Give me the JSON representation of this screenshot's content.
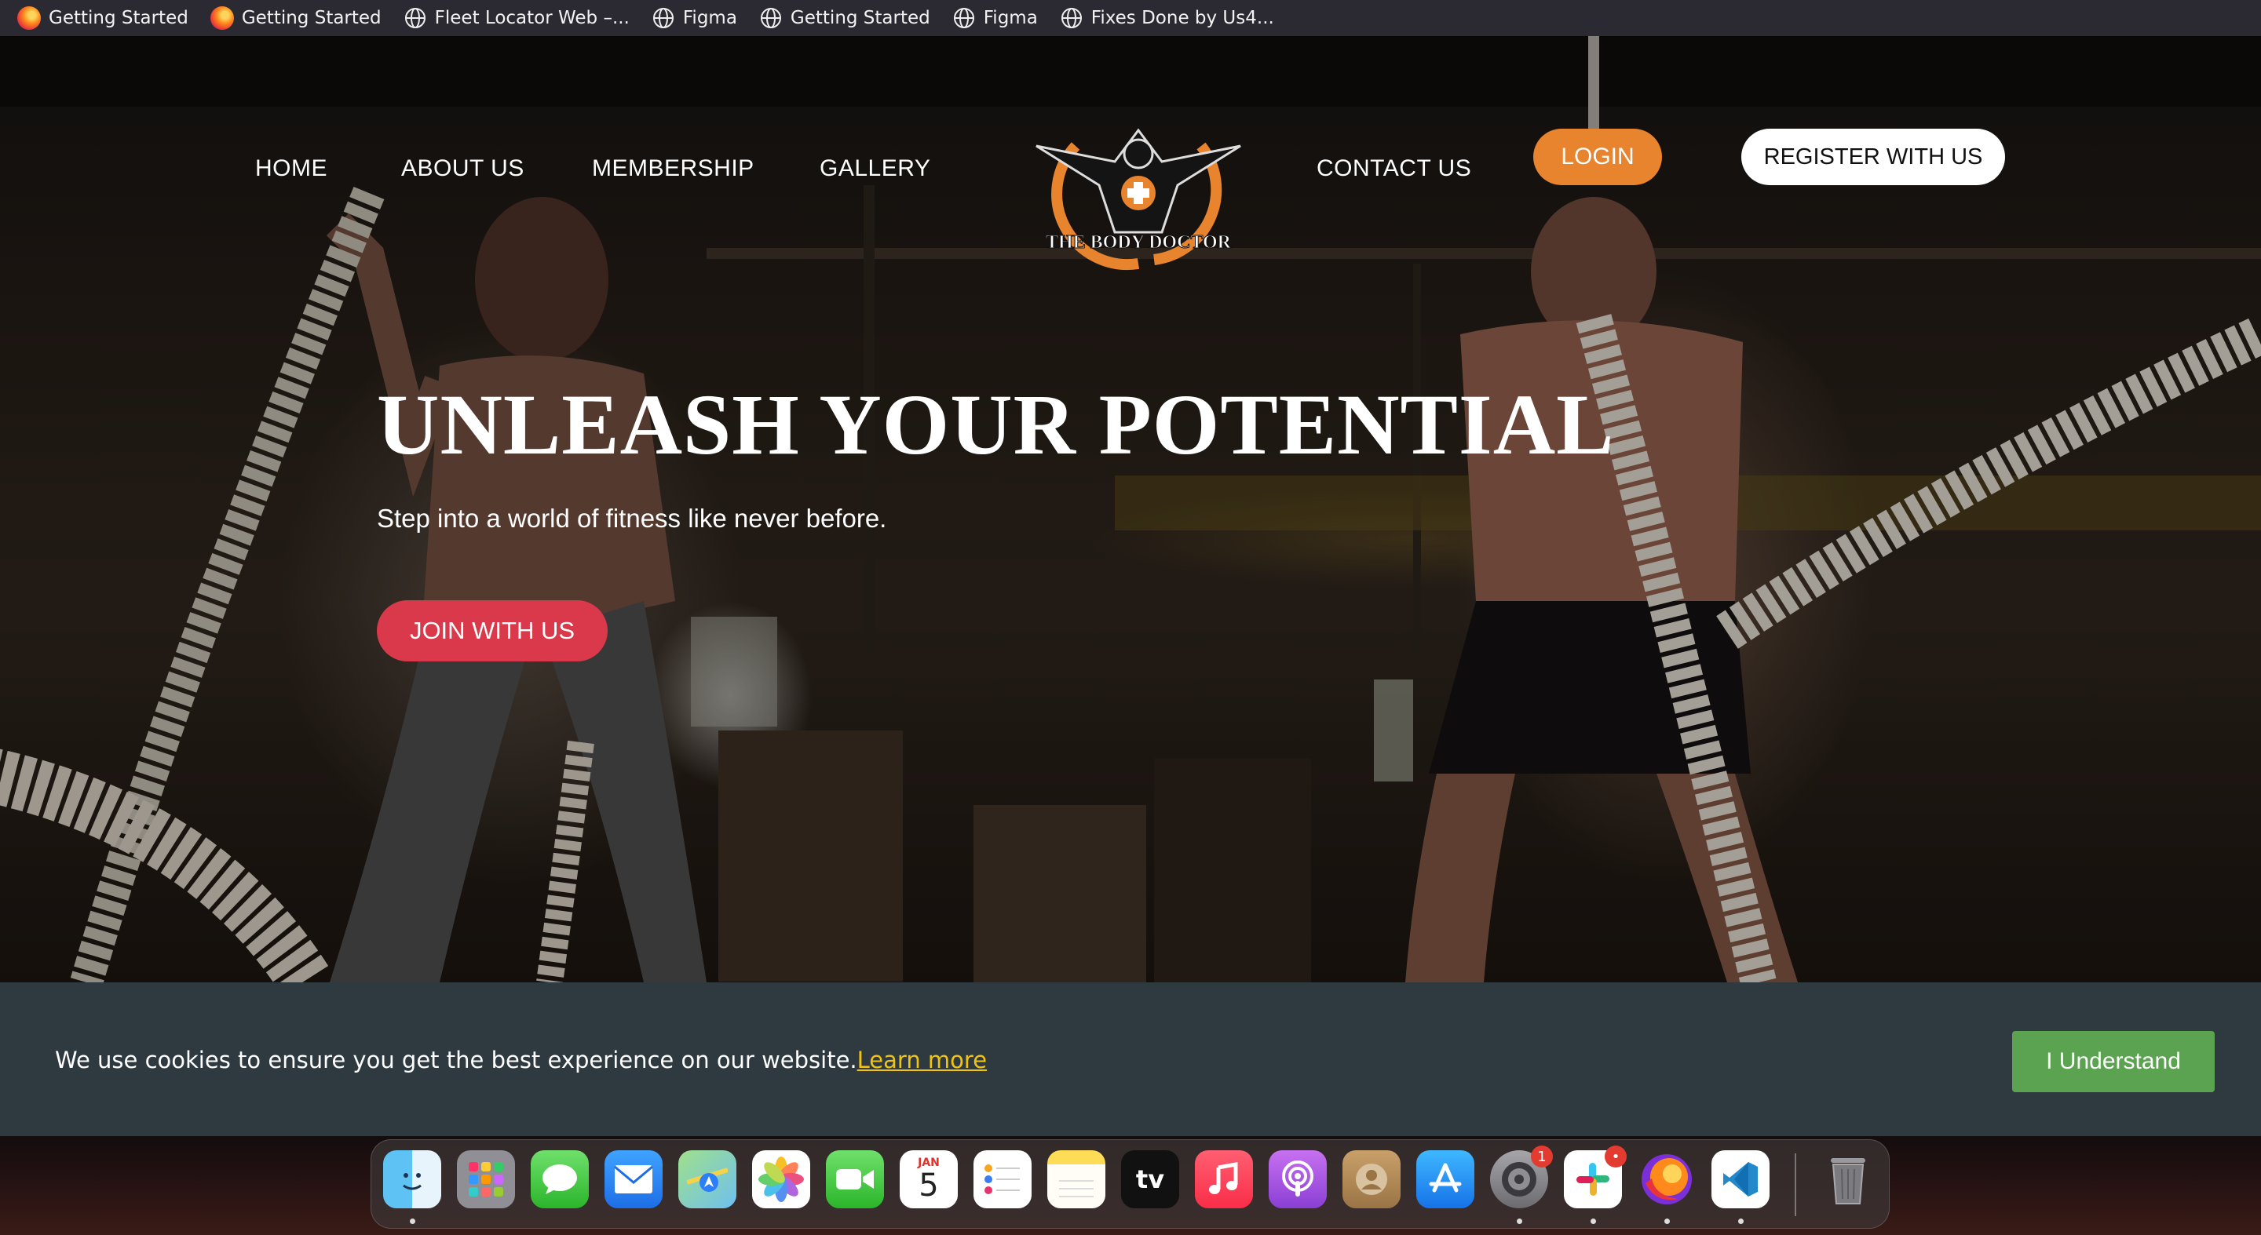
{
  "bookmarks": [
    {
      "label": "Getting Started",
      "icon": "firefox-icon"
    },
    {
      "label": "Getting Started",
      "icon": "firefox-icon"
    },
    {
      "label": "Fleet Locator Web –...",
      "icon": "globe-icon"
    },
    {
      "label": "Figma",
      "icon": "globe-icon"
    },
    {
      "label": "Getting Started",
      "icon": "globe-icon"
    },
    {
      "label": "Figma",
      "icon": "globe-icon"
    },
    {
      "label": "Fixes Done by Us4...",
      "icon": "globe-icon"
    }
  ],
  "nav": {
    "home": "HOME",
    "about": "ABOUT US",
    "membership": "MEMBERSHIP",
    "gallery": "GALLERY",
    "contact": "CONTACT US",
    "login": "LOGIN",
    "register": "REGISTER WITH US"
  },
  "logo": {
    "text": "THE BODY DOCTOR"
  },
  "hero": {
    "headline": "UNLEASH YOUR POTENTIAL",
    "subline": "Step into a world of fitness like never before.",
    "cta": "JOIN WITH US"
  },
  "cookie": {
    "message": "We use cookies to ensure you get the best experience on our website.",
    "link": "Learn more",
    "button": "I Understand"
  },
  "dock": {
    "calendar_month": "JAN",
    "calendar_day": "5",
    "tv_label": "tv",
    "settings_badge": "1",
    "slack_badge": "•"
  },
  "colors": {
    "login": "#e8832e",
    "join": "#d9394a",
    "cookie_bg": "#2e3a40",
    "cookie_link": "#f1c40f",
    "cookie_button": "#5ba350"
  }
}
